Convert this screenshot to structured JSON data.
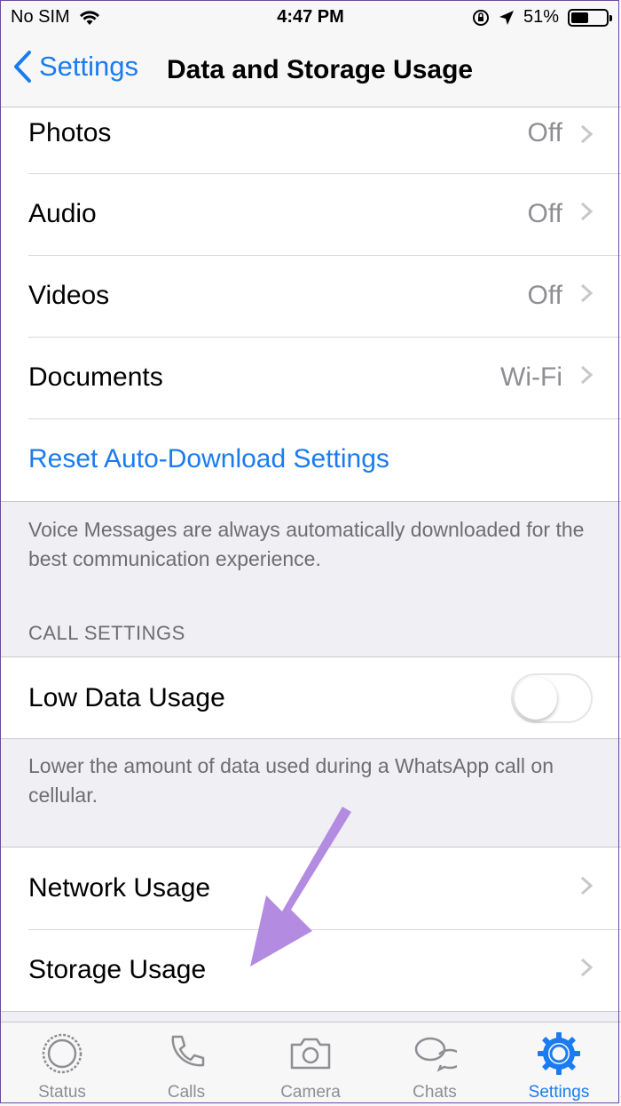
{
  "status_bar": {
    "carrier": "No SIM",
    "time": "4:47 PM",
    "battery": "51%"
  },
  "nav": {
    "back_label": "Settings",
    "title": "Data and Storage Usage"
  },
  "media_rows": [
    {
      "label": "Photos",
      "value": "Off"
    },
    {
      "label": "Audio",
      "value": "Off"
    },
    {
      "label": "Videos",
      "value": "Off"
    },
    {
      "label": "Documents",
      "value": "Wi-Fi"
    }
  ],
  "reset_label": "Reset Auto-Download Settings",
  "voice_note": "Voice Messages are always automatically downloaded for the best communication experience.",
  "call_settings": {
    "header": "CALL SETTINGS",
    "low_data_label": "Low Data Usage",
    "low_data_enabled": false,
    "note": "Lower the amount of data used during a WhatsApp call on cellular."
  },
  "usage_rows": [
    {
      "label": "Network Usage"
    },
    {
      "label": "Storage Usage"
    }
  ],
  "tabs": [
    {
      "label": "Status",
      "icon": "status-icon"
    },
    {
      "label": "Calls",
      "icon": "phone-icon"
    },
    {
      "label": "Camera",
      "icon": "camera-icon"
    },
    {
      "label": "Chats",
      "icon": "chat-bubbles-icon"
    },
    {
      "label": "Settings",
      "icon": "gear-icon",
      "active": true
    }
  ],
  "colors": {
    "accent": "#1a7cf0",
    "arrow": "#b38be0"
  }
}
